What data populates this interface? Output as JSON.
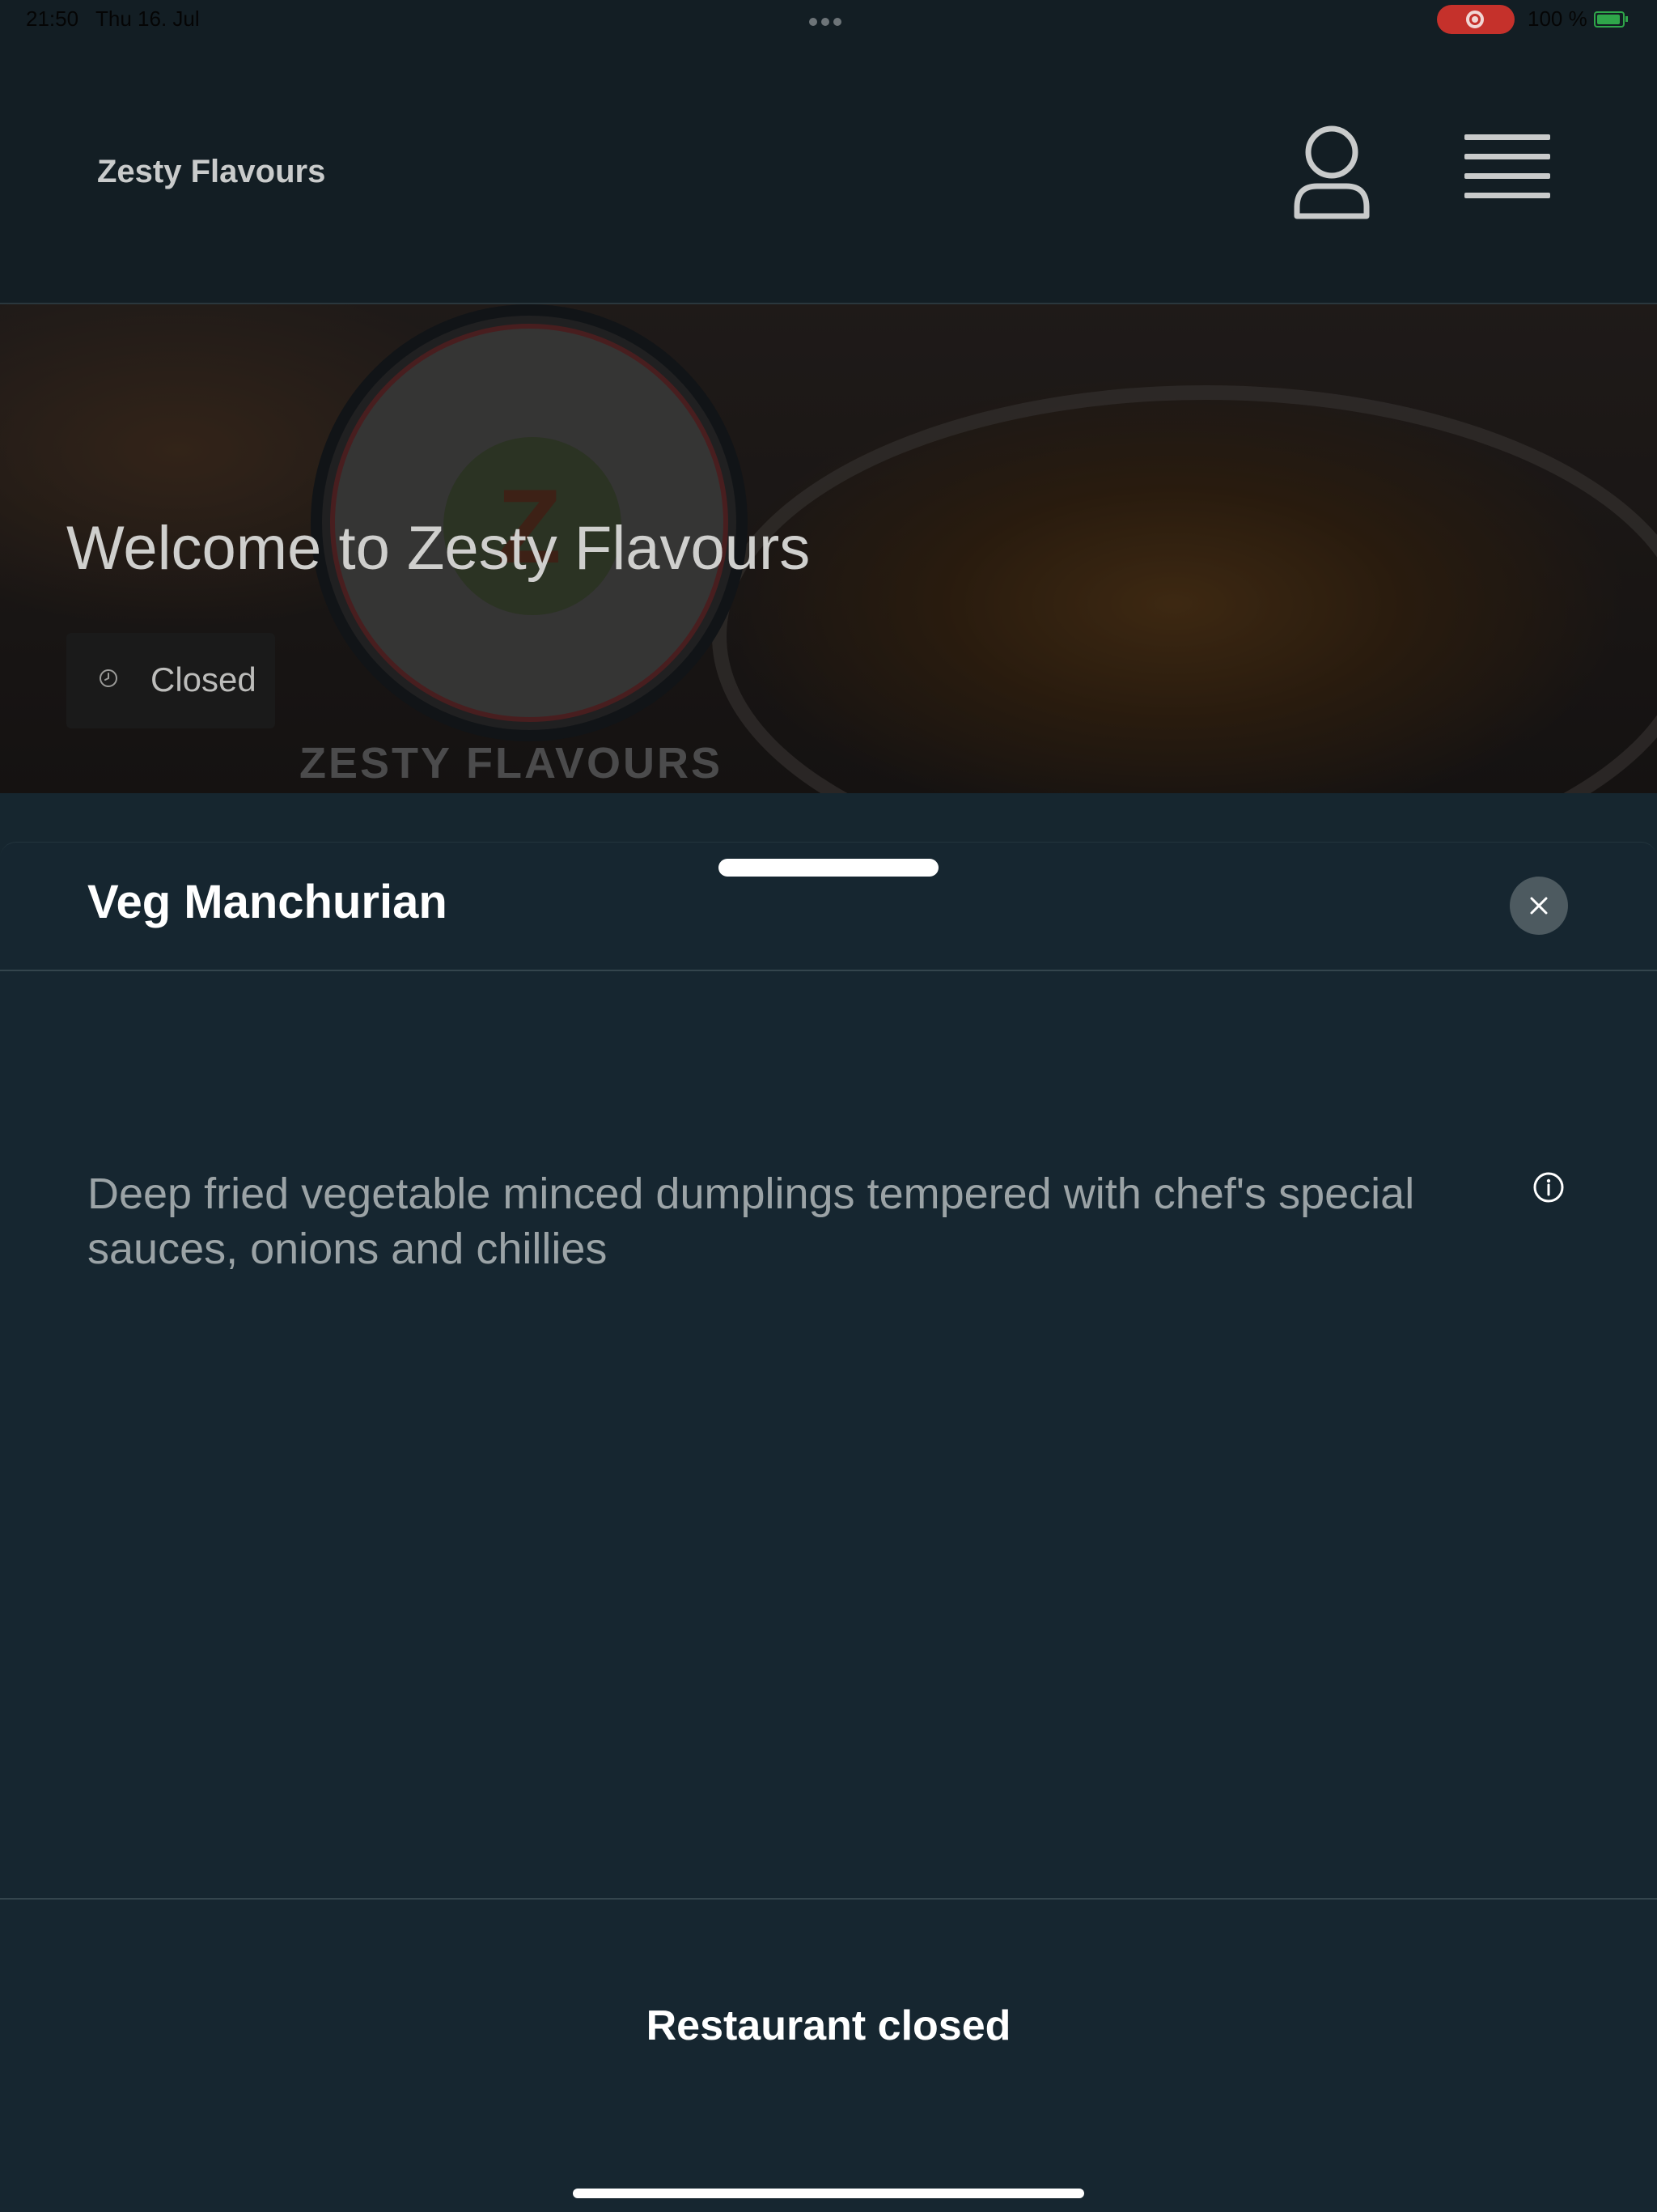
{
  "status_bar": {
    "time": "21:50",
    "date": "Thu 16. Jul",
    "battery": "100 %"
  },
  "header": {
    "brand": "Zesty Flavours",
    "icons": [
      "user-icon",
      "menu-icon"
    ]
  },
  "hero": {
    "welcome": "Welcome to Zesty Flavours",
    "status_label": "Closed",
    "logo_text": "ZESTY FLAVOURS"
  },
  "item_sheet": {
    "title": "Veg Manchurian",
    "description": "Deep fried vegetable minced dumplings tempered with chef's special sauces, onions and chillies",
    "footer_status": "Restaurant closed"
  },
  "colors": {
    "background": "#16262f",
    "header": "#131e24",
    "recording": "#c5312b",
    "battery": "#2fa64a"
  }
}
